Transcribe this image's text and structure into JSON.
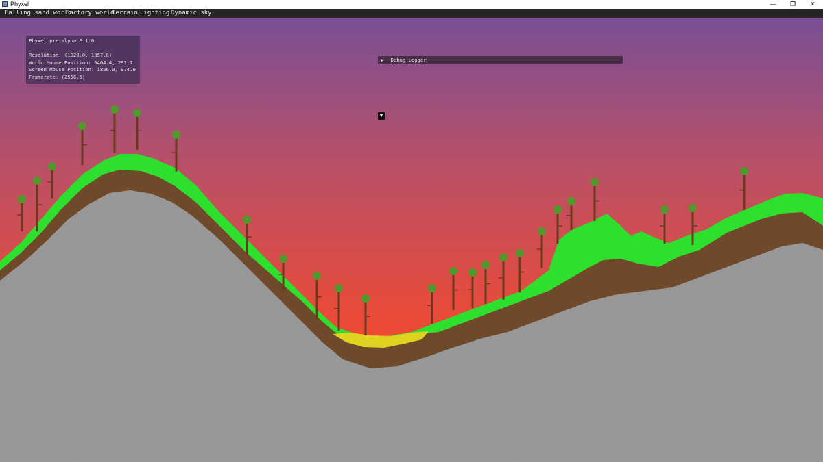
{
  "window": {
    "title": "Phyxel",
    "minimize_glyph": "—",
    "restore_glyph": "❐",
    "close_glyph": "✕"
  },
  "menu": [
    "Falling sand world",
    "Factory world",
    "Terrain",
    "Lighting",
    "Dynamic sky"
  ],
  "overlay": {
    "version": "Phyxel pre-alpha 0.1.0",
    "resolution": "Resolution: (1920.0, 1057.0)",
    "world_mouse": "World Mouse Position: 5404.4, 291.7",
    "screen_mouse": "Screen Mouse Position: 1856.0, 974.0",
    "framerate": "Framerate: (2566.5)"
  },
  "debug_logger": {
    "arrow": "▶",
    "label": "Debug Logger"
  },
  "dropdown_arrow": "▼",
  "colors": {
    "sky_top": "#7a4f95",
    "sky_mid": "#b85068",
    "sky_bottom": "#f04a32",
    "grass": "#2ee02e",
    "dirt": "#6e4a2a",
    "stone": "#8e8e8e",
    "sand": "#e0d21e",
    "trunk": "#6b3a1e",
    "canopy": "#4f9a2a"
  }
}
